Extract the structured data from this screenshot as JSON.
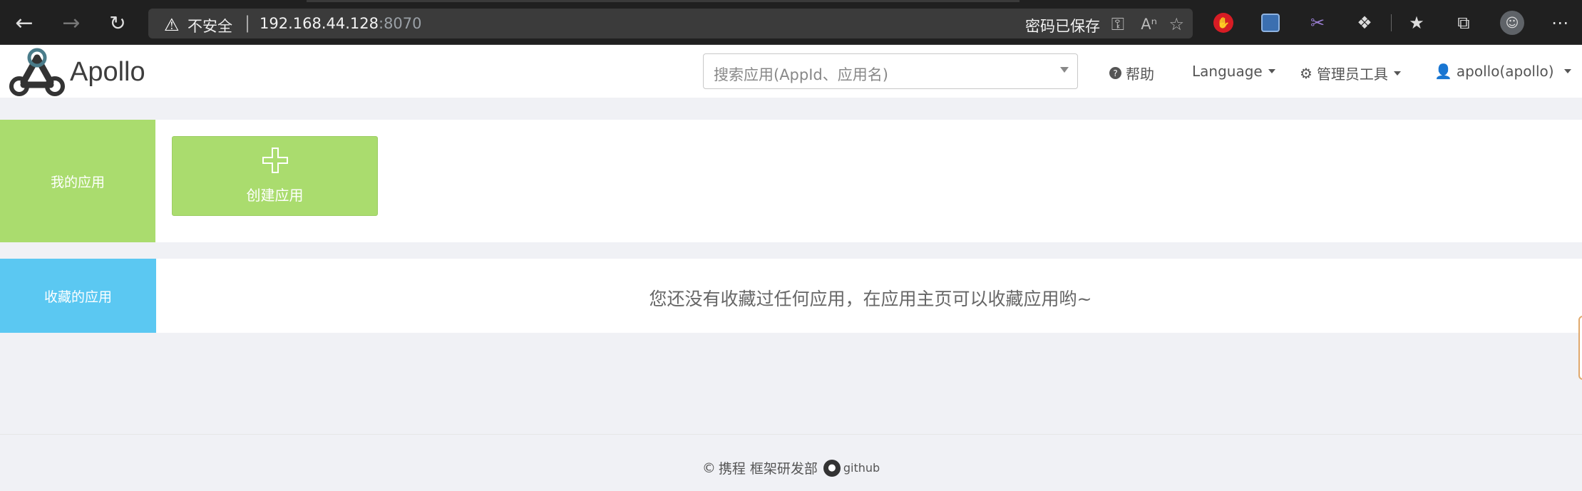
{
  "browser": {
    "insecure_label": "不安全",
    "host": "192.168.44.128",
    "port": ":8070",
    "password_saved": "密码已保存"
  },
  "app": {
    "logo_text": "Apollo",
    "search_placeholder": "搜索应用(AppId、应用名)",
    "nav": {
      "help": "帮助",
      "language": "Language",
      "admin_tools": "管理员工具",
      "user": "apollo(apollo)"
    }
  },
  "my_apps": {
    "section_label": "我的应用",
    "create_label": "创建应用"
  },
  "favorites": {
    "section_label": "收藏的应用",
    "empty_message": "您还没有收藏过任何应用，在应用主页可以收藏应用哟~"
  },
  "footer": {
    "company": "携程 框架研发部",
    "github": "github"
  },
  "colors": {
    "green": "#aadc6e",
    "blue": "#5bc8f2"
  }
}
